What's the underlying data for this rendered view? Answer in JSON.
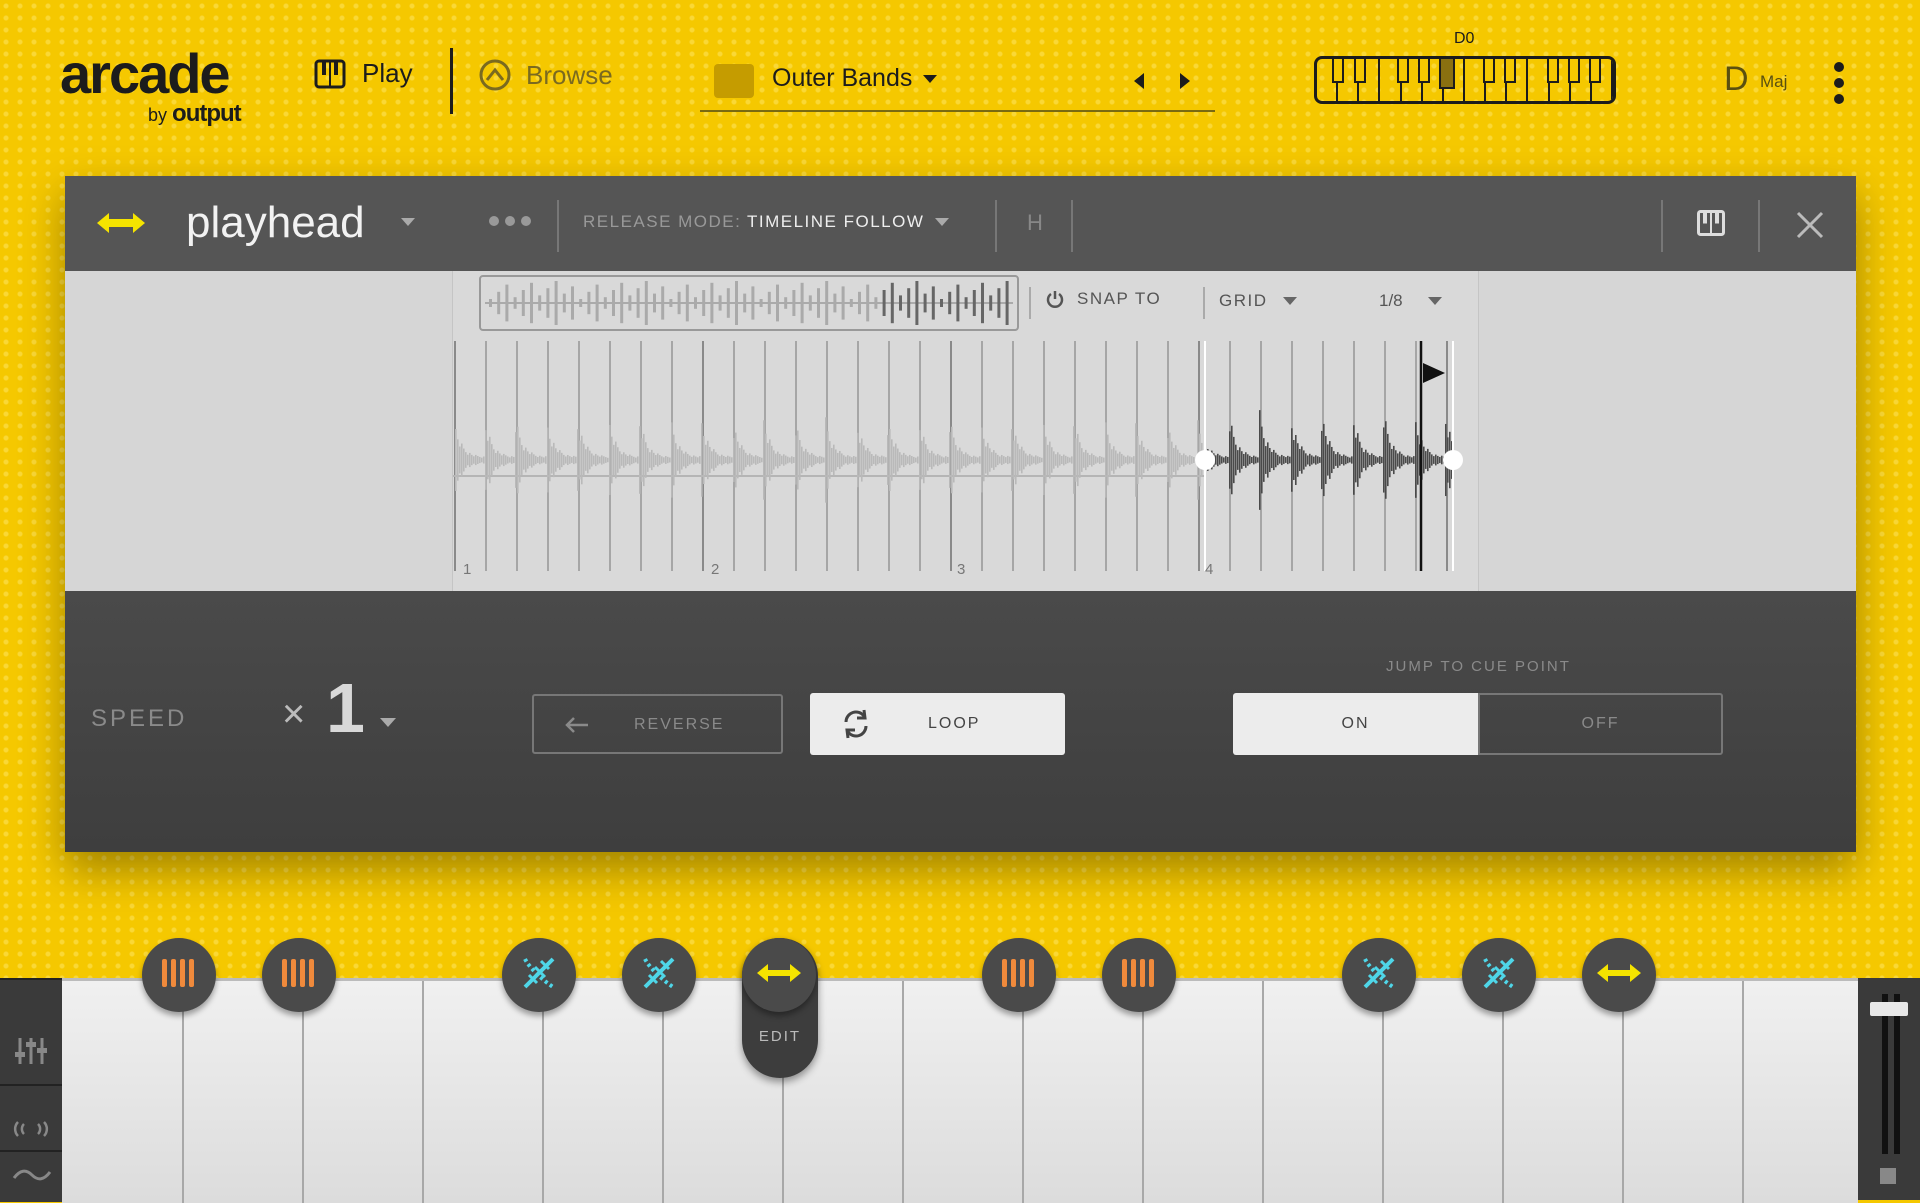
{
  "app": {
    "logo": "arcade",
    "logo_by": "by",
    "logo_brand": "output"
  },
  "nav": {
    "play_label": "Play",
    "browse_label": "Browse"
  },
  "preset": {
    "name": "Outer Bands"
  },
  "key_selector": {
    "root_label": "D0",
    "note": "D",
    "scale": "Maj"
  },
  "panel": {
    "title": "playhead",
    "release_mode_label": "RELEASE MODE:",
    "release_mode_value": "TIMELINE FOLLOW",
    "h_label": "H",
    "snap_label": "SNAP TO",
    "grid_label": "GRID",
    "grid_value": "1/8",
    "bars": [
      "1",
      "2",
      "3",
      "4"
    ],
    "speed_label": "SPEED",
    "speed_multiplier": "×",
    "speed_value": "1",
    "reverse_label": "REVERSE",
    "loop_label": "LOOP",
    "jump_label": "JUMP TO CUE POINT",
    "jump_on": "ON",
    "jump_off": "OFF"
  },
  "keyboard": {
    "edit_label": "EDIT",
    "pads": [
      {
        "icon": "bars-icon",
        "color": "#f08a3c"
      },
      {
        "icon": "bars-icon",
        "color": "#f08a3c"
      },
      {
        "icon": "dna-icon",
        "color": "#4fd6e8"
      },
      {
        "icon": "dna-icon",
        "color": "#4fd6e8"
      },
      {
        "icon": "playhead-arrows-icon",
        "color": "#f5e400"
      },
      {
        "icon": "bars-icon",
        "color": "#f08a3c"
      },
      {
        "icon": "bars-icon",
        "color": "#f08a3c"
      },
      {
        "icon": "dna-icon",
        "color": "#4fd6e8"
      },
      {
        "icon": "dna-icon",
        "color": "#4fd6e8"
      },
      {
        "icon": "playhead-arrows-icon",
        "color": "#f5e400"
      }
    ]
  },
  "colors": {
    "background": "#f5c800",
    "accent_yellow": "#f5e400",
    "panel_dark": "#555555"
  }
}
